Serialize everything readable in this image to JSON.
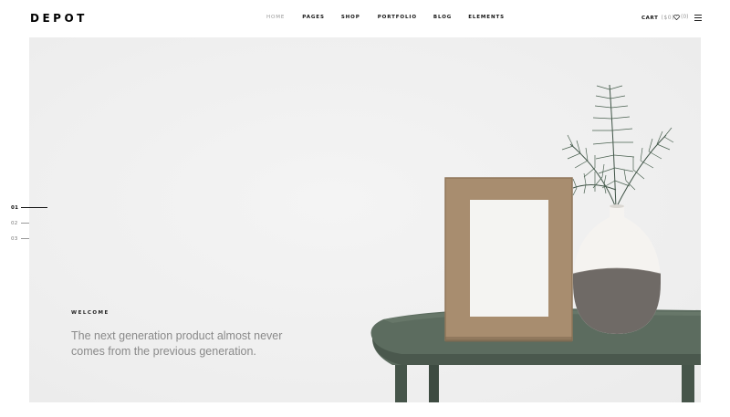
{
  "header": {
    "logo": "DEPOT",
    "nav": [
      {
        "label": "HOME",
        "active": true
      },
      {
        "label": "PAGES",
        "active": false
      },
      {
        "label": "SHOP",
        "active": false
      },
      {
        "label": "PORTFOLIO",
        "active": false
      },
      {
        "label": "BLOG",
        "active": false
      },
      {
        "label": "ELEMENTS",
        "active": false
      }
    ],
    "cart_label": "CART",
    "cart_amount": "($0)",
    "wishlist_count": "(0)",
    "icons": {
      "wishlist": "heart-icon",
      "menu": "hamburger-menu-icon"
    }
  },
  "hero": {
    "slides": [
      {
        "number": "01",
        "active": true
      },
      {
        "number": "02",
        "active": false
      },
      {
        "number": "03",
        "active": false
      }
    ],
    "eyebrow": "WELCOME",
    "headline": "The next generation product almost never comes from the previous generation."
  },
  "colors": {
    "hero_background": "#f1f1f1",
    "table": "#5d6e60",
    "frame_wood": "#a88d6f",
    "vase_top": "#f5f3f0",
    "vase_bottom": "#6f6a66",
    "pine": "#3f5346"
  }
}
